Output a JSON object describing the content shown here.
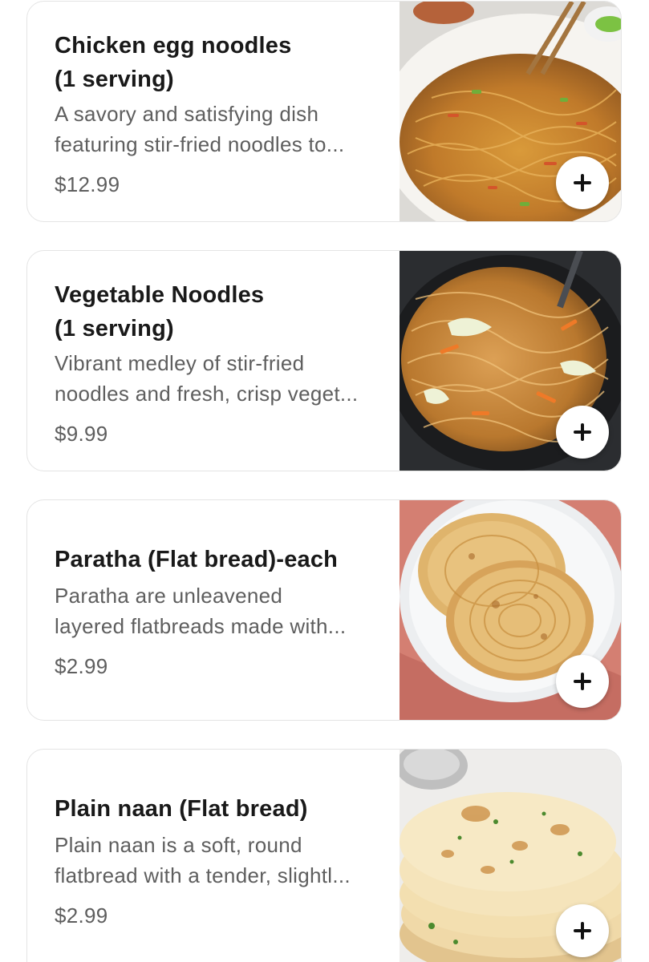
{
  "menu_items": [
    {
      "title_line1": "Chicken egg noodles",
      "title_line2": "(1 serving)",
      "desc_line1": "A savory and satisfying dish",
      "desc_line2": "featuring stir-fried noodles to...",
      "price": "$12.99",
      "image": "chicken-noodles-photo"
    },
    {
      "title_line1": "Vegetable Noodles",
      "title_line2": "(1 serving)",
      "desc_line1": "Vibrant medley of stir-fried",
      "desc_line2": "noodles and fresh, crisp veget...",
      "price": "$9.99",
      "image": "vegetable-noodles-photo"
    },
    {
      "title_line1": "Paratha (Flat bread)-each",
      "desc_line1": "Paratha are unleavened",
      "desc_line2": "layered flatbreads made with...",
      "price": "$2.99",
      "image": "paratha-photo"
    },
    {
      "title_line1": "Plain naan (Flat bread)",
      "desc_line1": "Plain naan is a soft, round",
      "desc_line2": "flatbread with a tender, slightl...",
      "price": "$2.99",
      "image": "naan-photo"
    }
  ],
  "icons": {
    "add": "plus-icon"
  },
  "colors": {
    "title": "#191919",
    "secondary_text": "#5e5e5e",
    "card_border": "#e4e4e4"
  }
}
